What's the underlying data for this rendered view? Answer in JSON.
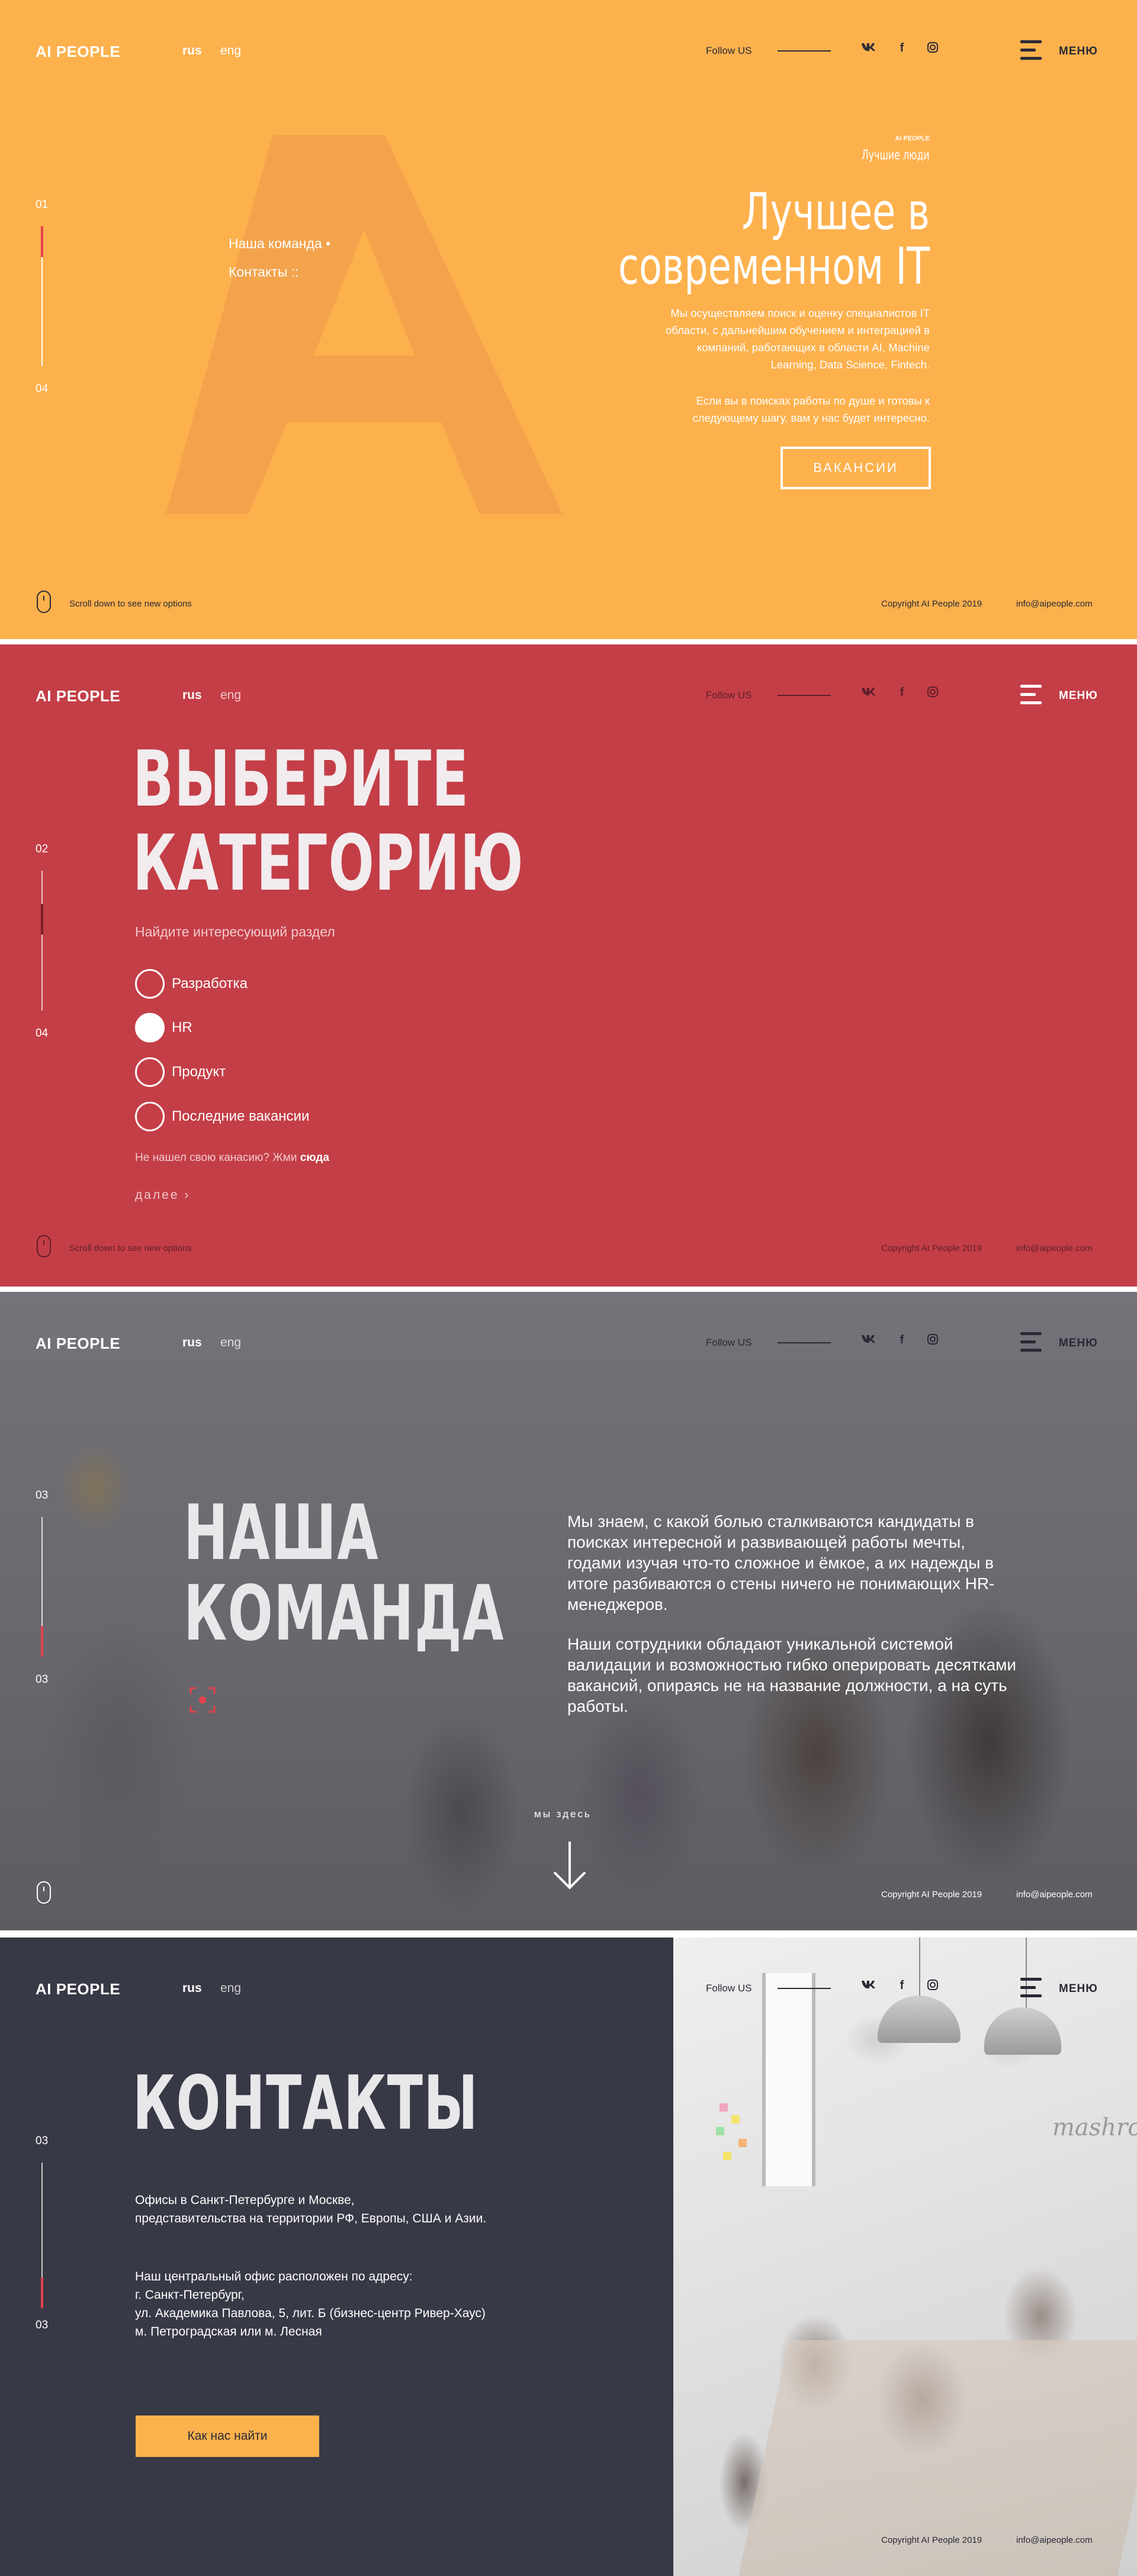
{
  "header": {
    "logo": "AI PEOPLE",
    "lang_rus": "rus",
    "lang_eng": "eng",
    "follow": "Follow US",
    "social": {
      "vk": "vk",
      "fb": "f",
      "ig": "◎"
    },
    "menu": "МЕНЮ"
  },
  "footer": {
    "scroll_hint": "Scroll down to see new options",
    "copyright": "Copyright AI People 2019",
    "email": "info@aipeople.com"
  },
  "colors": {
    "yellow": "#fdb14d",
    "red": "#c43e47",
    "dark": "#383946",
    "accent": "#e3424c"
  },
  "section1": {
    "progress_top": "01",
    "progress_bottom": "04",
    "nav": [
      "Наша команда •",
      "Контакты ::"
    ],
    "small_label": "AI PEOPLE",
    "tagline": "Лучшие люди",
    "title_line1": "Лучшее в",
    "title_line2": "современном IT",
    "paragraph1_line1": "Мы осуществляем поиск и оценку специалистов IT",
    "paragraph1_line2": "области, с дальнейшим обучением и интеграцией в",
    "paragraph1_line3": "компаний, работающих в области AI, Machine",
    "paragraph1_line4": "Learning, Data Science, Fintech.",
    "paragraph2_line1": "Если вы в поисках работы по душе и готовы к",
    "paragraph2_line2": "следующему шагу, вам у нас будет интересно.",
    "button": "ВАКАНСИИ"
  },
  "section2": {
    "progress_top": "02",
    "progress_bottom": "04",
    "title_line1": "ВЫБЕРИТЕ",
    "title_line2": "КАТЕГОРИЮ",
    "subtitle": "Найдите интересующий раздел",
    "options": [
      "Разработка",
      "HR",
      "Продукт",
      "Последние вакансии"
    ],
    "selected_option": "HR",
    "not_found_text": "Не нашел свою канасию? Жми ",
    "not_found_link": "сюда",
    "next": "далее"
  },
  "section3": {
    "progress_top": "03",
    "progress_bottom": "03",
    "title_line1": "НАША",
    "title_line2": "КОМАНДА",
    "paragraph1": "Мы знаем, с какой болью сталкиваются кандидаты в поисках интересной и развивающей работы мечты, годами изучая что-то сложное и ёмкое, а их надежды в итоге разбиваются о стены ничего не понимающих HR-менеджеров.",
    "paragraph2": "Наши сотрудники обладают уникальной системой валидации и возможностью гибко оперировать десятками вакансий, опираясь не на название должности, а на суть работы.",
    "here": "мы здесь"
  },
  "section4": {
    "progress_top": "03",
    "progress_bottom": "03",
    "title": "КОНТАКТЫ",
    "offices_line1": "Офисы в Санкт-Петербурге и Москве,",
    "offices_line2": "представительства на территории РФ, Европы, США и Азии.",
    "address_line1": "Наш центральный офис расположен по адресу:",
    "address_line2": "г. Санкт-Петербург,",
    "address_line3": "ул. Академика Павлова, 5, лит. Б (бизнес-центр Ривер-Хаус)",
    "address_line4": "м. Петроградская или м. Лесная",
    "button": "Как нас найти",
    "photo_brand": "mashro"
  }
}
